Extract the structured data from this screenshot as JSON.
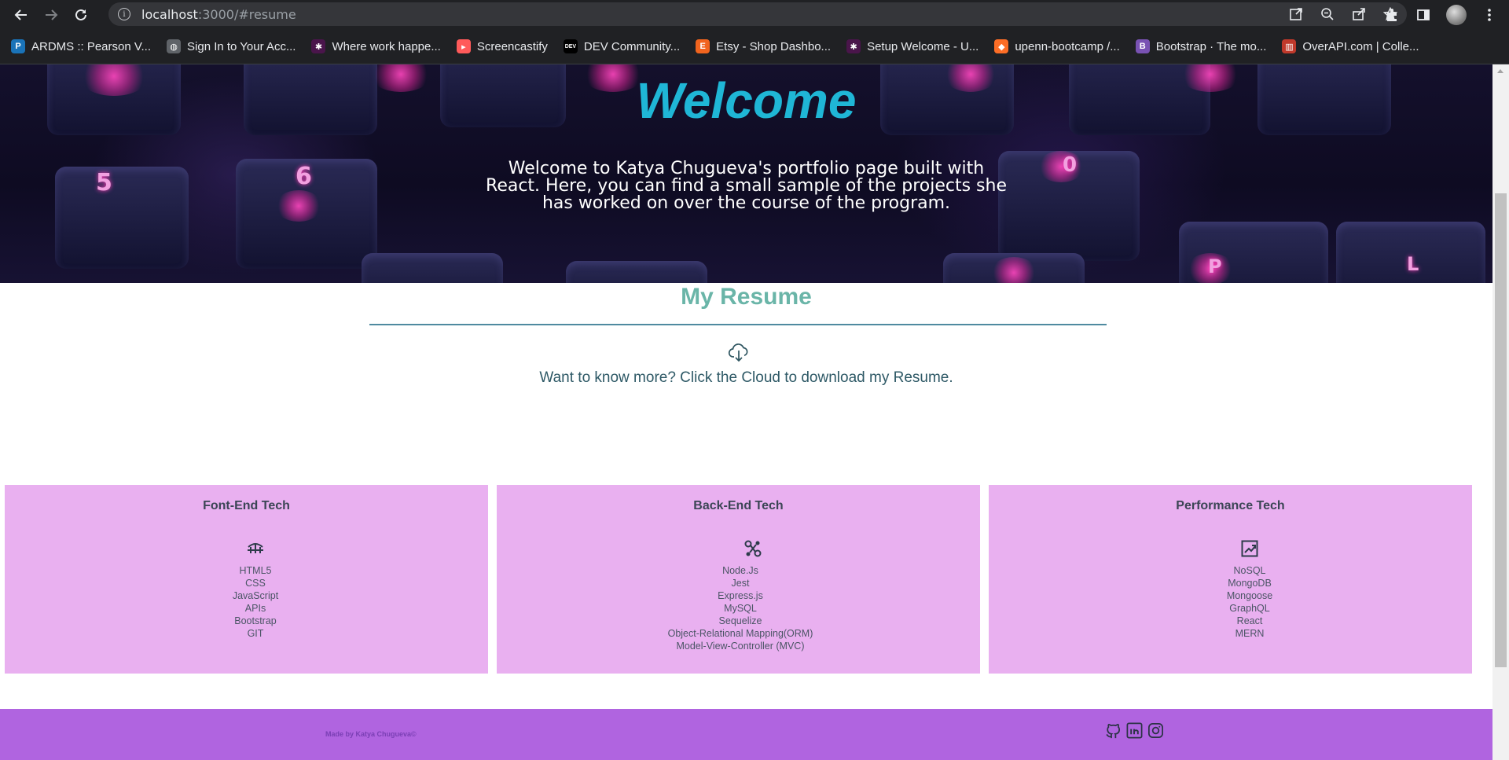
{
  "browser": {
    "url_host": "localhost",
    "url_rest": ":3000/#resume",
    "bookmarks": [
      {
        "label": "ARDMS :: Pearson V...",
        "icon": "pearson-icon",
        "color": "#1a73b8"
      },
      {
        "label": "Sign In to Your Acc...",
        "icon": "globe-icon",
        "color": "#5f6368"
      },
      {
        "label": "Where work happe...",
        "icon": "slack-icon",
        "color": "#4a154b"
      },
      {
        "label": "Screencastify",
        "icon": "screencastify-icon",
        "color": "#ff5a5a"
      },
      {
        "label": "DEV Community...",
        "icon": "dev-icon",
        "color": "#000000"
      },
      {
        "label": "Etsy - Shop Dashbo...",
        "icon": "etsy-icon",
        "color": "#f1641e"
      },
      {
        "label": "Setup Welcome - U...",
        "icon": "slack-icon",
        "color": "#4a154b"
      },
      {
        "label": "upenn-bootcamp /...",
        "icon": "gitlab-icon",
        "color": "#fc6d26"
      },
      {
        "label": "Bootstrap · The mo...",
        "icon": "bootstrap-icon",
        "color": "#7952b3"
      },
      {
        "label": "OverAPI.com | Colle...",
        "icon": "overapi-icon",
        "color": "#c0392b"
      }
    ]
  },
  "hero": {
    "title": "Welcome",
    "text": "Welcome to Katya Chugueva's portfolio page built with React. Here, you can find a small sample of the projects she has worked on over the course of the program."
  },
  "resume": {
    "title": "My Resume",
    "text": "Want to know more? Click the Cloud to download my Resume."
  },
  "cards": [
    {
      "title": "Font-End Tech",
      "icon": "bridge-icon",
      "items": [
        "HTML5",
        "CSS",
        "JavaScript",
        "APIs",
        "Bootstrap",
        "GIT"
      ]
    },
    {
      "title": "Back-End Tech",
      "icon": "nodes-icon",
      "items": [
        "Node.Js",
        "Jest",
        "Express.js",
        "MySQL",
        "Sequelize",
        "Object-Relational Mapping(ORM)",
        "Model-View-Controller (MVC)"
      ]
    },
    {
      "title": "Performance Tech",
      "icon": "chart-up-icon",
      "items": [
        "NoSQL",
        "MongoDB",
        "Mongoose",
        "GraphQL",
        "React",
        "MERN"
      ]
    }
  ],
  "footer": {
    "text": "Made by Katya Chugueva©",
    "icons": [
      "github-icon",
      "linkedin-icon",
      "instagram-icon"
    ]
  },
  "colors": {
    "accent_title": "#1fb6d6",
    "resume_title": "#6ab5a8",
    "card_bg": "#e9b0f0",
    "footer_bg": "#b064e0"
  }
}
